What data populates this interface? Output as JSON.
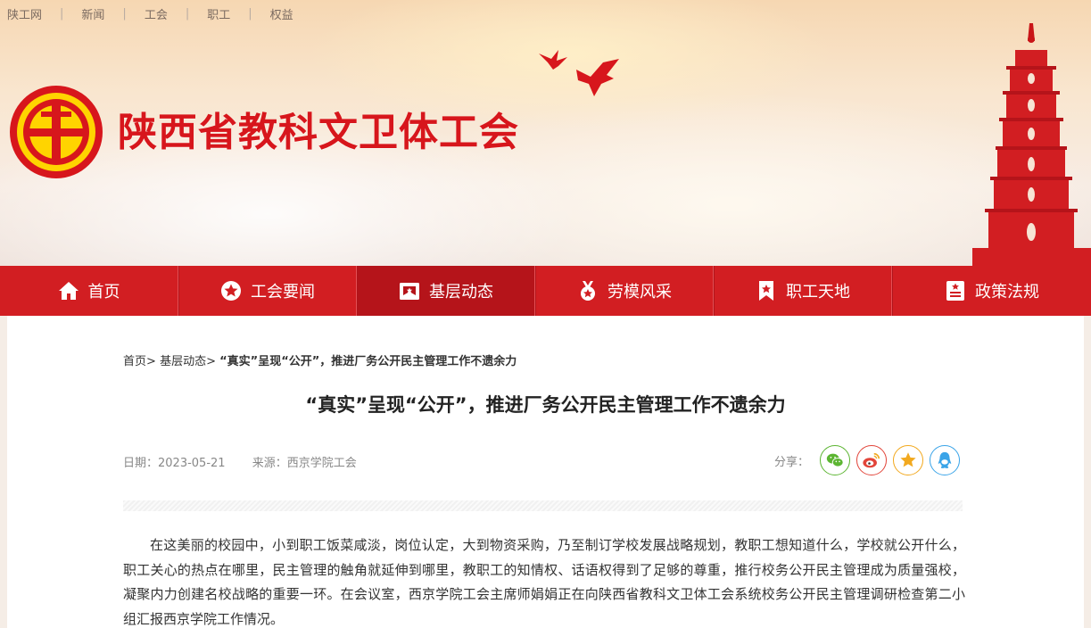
{
  "top_links": [
    "陕工网",
    "新闻",
    "工会",
    "职工",
    "权益"
  ],
  "site": {
    "title": "陕西省教科文卫体工会"
  },
  "nav": [
    {
      "label": "首页",
      "icon": "home-icon"
    },
    {
      "label": "工会要闻",
      "icon": "star-badge-icon"
    },
    {
      "label": "基层动态",
      "icon": "flag-icon",
      "active": true
    },
    {
      "label": "劳模风采",
      "icon": "medal-icon"
    },
    {
      "label": "职工天地",
      "icon": "bookmark-star-icon"
    },
    {
      "label": "政策法规",
      "icon": "document-icon"
    }
  ],
  "breadcrumb": {
    "home": "首页",
    "sep1": ">",
    "section": "基层动态",
    "sep2": ">",
    "current": "“真实”呈现“公开”，推进厂务公开民主管理工作不遗余力"
  },
  "article": {
    "title": "“真实”呈现“公开”，推进厂务公开民主管理工作不遗余力",
    "date": "日期：2023-05-21",
    "source": "来源：西京学院工会",
    "share_label": "分享：",
    "share": [
      {
        "name": "wechat-icon",
        "color": "#5cb532"
      },
      {
        "name": "weibo-icon",
        "color": "#e2453a"
      },
      {
        "name": "favorite-icon",
        "color": "#f2a91f"
      },
      {
        "name": "qq-icon",
        "color": "#3aa4e8"
      }
    ],
    "body": "在这美丽的校园中，小到职工饭菜咸淡，岗位认定，大到物资采购，乃至制订学校发展战略规划，教职工想知道什么，学校就公开什么，职工关心的热点在哪里，民主管理的触角就延伸到哪里，教职工的知情权、话语权得到了足够的尊重，推行校务公开民主管理成为质量强校，凝聚内力创建名校战略的重要一环。在会议室，西京学院工会主席师娟娟正在向陕西省教科文卫体工会系统校务公开民主管理调研检查第二小组汇报西京学院工作情况。"
  },
  "colors": {
    "brand_red": "#d21e22",
    "nav_active": "#b5141a",
    "title_red": "#d7161c"
  }
}
